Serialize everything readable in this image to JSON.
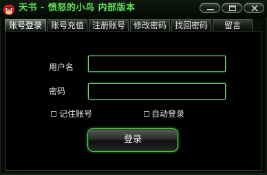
{
  "window": {
    "title": "天书 - 愤怒的小鸟 内部版本",
    "icon": "angry-bird-icon",
    "controls": [
      "minimize-icon",
      "maximize-icon",
      "close-icon"
    ],
    "accent_color": "#5ee05a"
  },
  "tabs": [
    {
      "label": "账号登录",
      "active": true
    },
    {
      "label": "账号充值",
      "active": false
    },
    {
      "label": "注册账号",
      "active": false
    },
    {
      "label": "修改密码",
      "active": false
    },
    {
      "label": "找回密码",
      "active": false
    },
    {
      "label": "留言",
      "active": false
    }
  ],
  "login_form": {
    "username_label": "用户名",
    "username_value": "",
    "password_label": "密码",
    "password_value": "",
    "remember_label": "记住账号",
    "remember_checked": false,
    "autologin_label": "自动登录",
    "autologin_checked": false,
    "submit_label": "登录"
  }
}
